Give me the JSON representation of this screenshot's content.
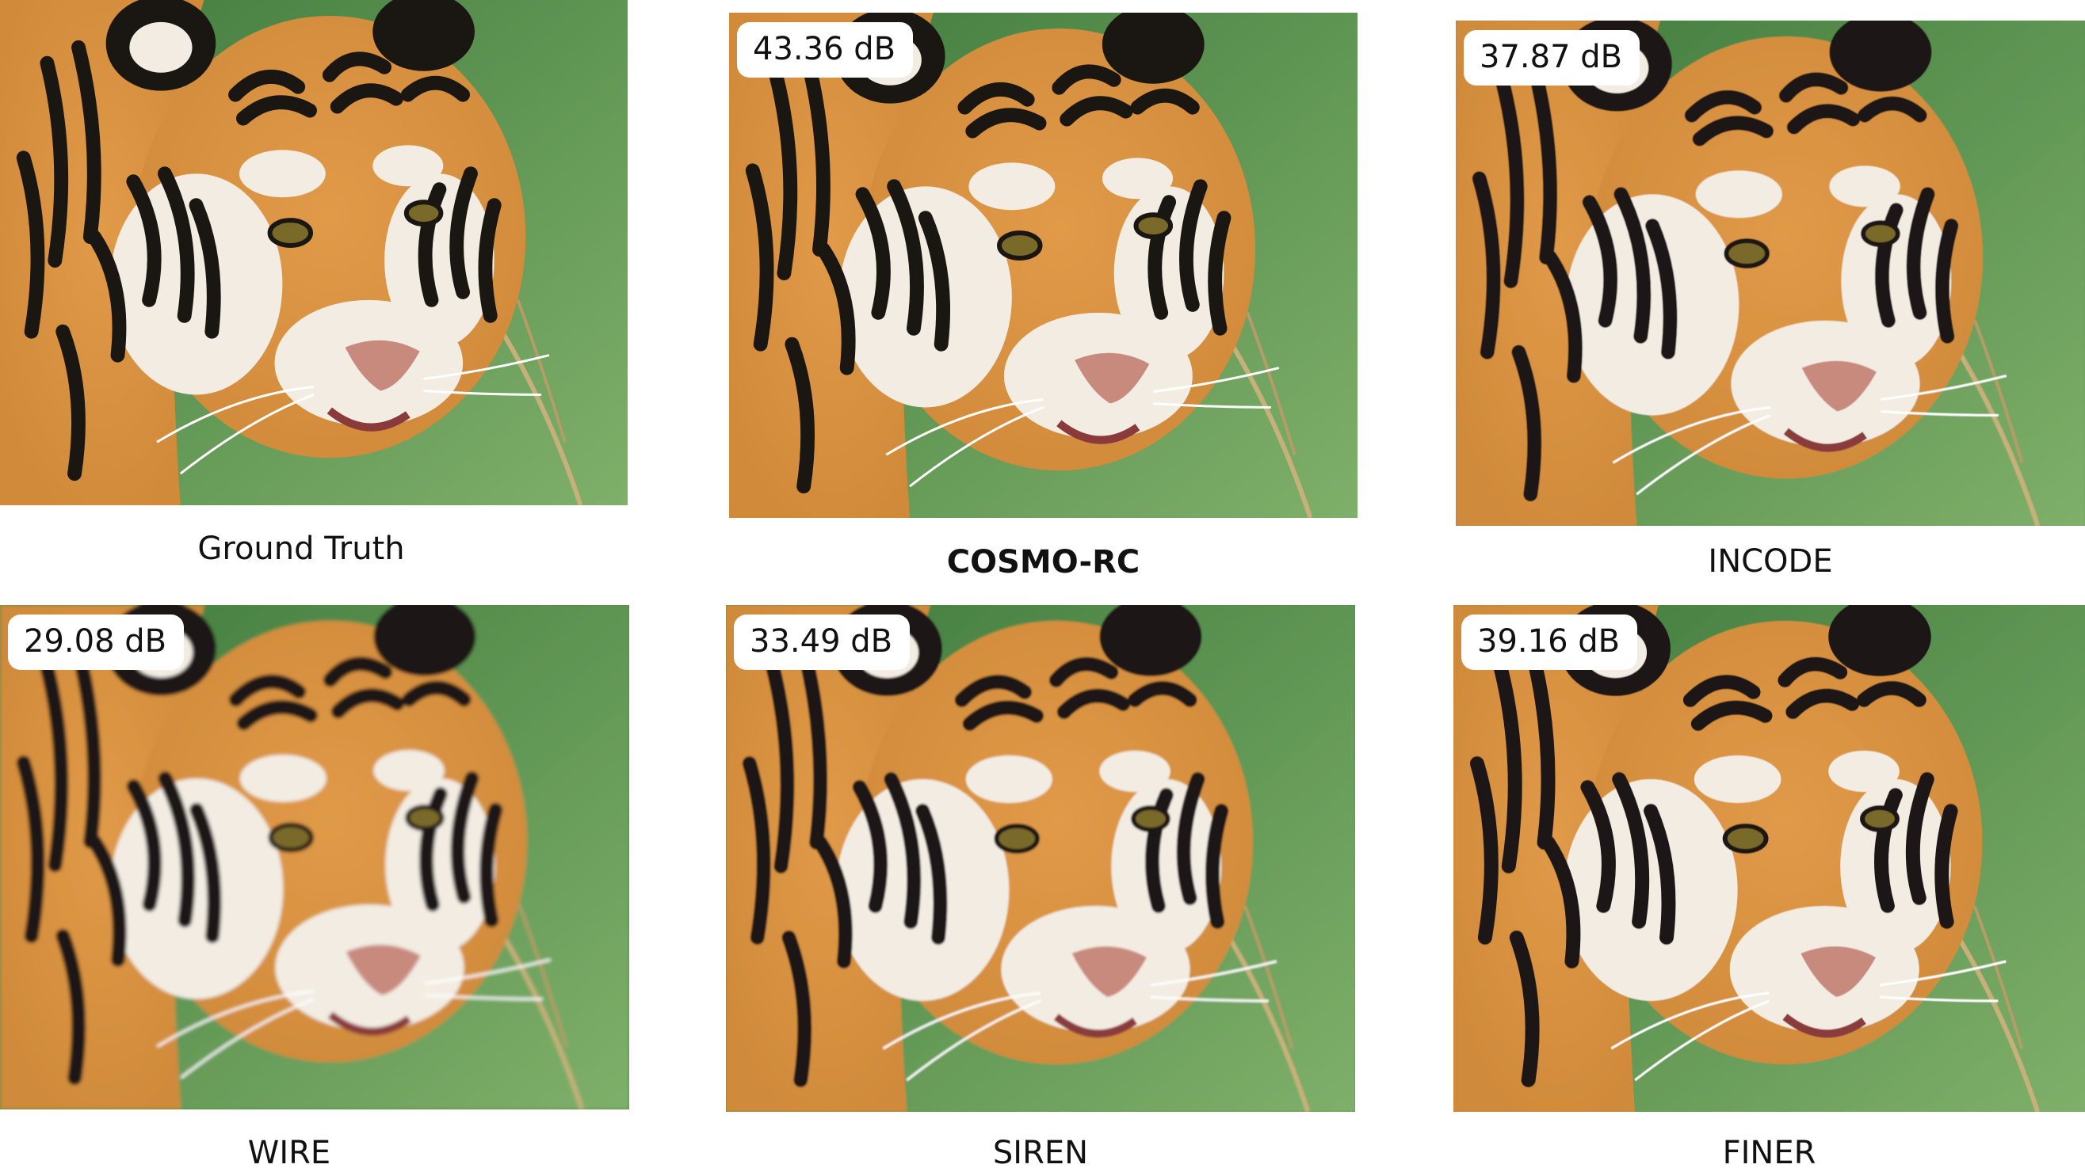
{
  "panels": [
    {
      "id": "gt",
      "caption": "Ground Truth",
      "psnr": null,
      "bold": false,
      "blur": 0
    },
    {
      "id": "cosmo",
      "caption": "COSMO-RC",
      "psnr": "43.36 dB",
      "bold": true,
      "blur": 0
    },
    {
      "id": "incode",
      "caption": "INCODE",
      "psnr": "37.87 dB",
      "bold": false,
      "blur": 0.6
    },
    {
      "id": "wire",
      "caption": "WIRE",
      "psnr": "29.08 dB",
      "bold": false,
      "blur": 2.2
    },
    {
      "id": "siren",
      "caption": "SIREN",
      "psnr": "33.49 dB",
      "bold": false,
      "blur": 1.2
    },
    {
      "id": "finer",
      "caption": "FINER",
      "psnr": "39.16 dB",
      "bold": false,
      "blur": 0.4
    }
  ],
  "colors": {
    "background": "#ffffff",
    "grass_light": "#7fb06a",
    "grass_dark": "#3f7a3c",
    "fur_orange": "#d08a3a",
    "fur_white": "#f2ece2",
    "stripe_black": "#1a1612",
    "text": "#111111"
  }
}
